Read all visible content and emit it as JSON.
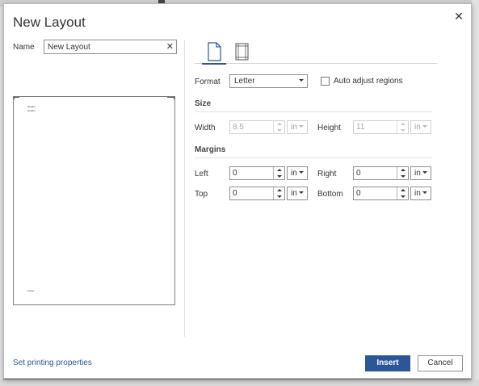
{
  "dialog": {
    "title": "New Layout",
    "close_icon": "close-icon"
  },
  "name": {
    "label": "Name",
    "value": "New Layout",
    "clear_icon": "clear-icon"
  },
  "preview": {
    "header_lines": [
      "Header",
      "Header"
    ],
    "footer_line": "Footer"
  },
  "tabs": [
    {
      "name": "page-setup",
      "icon": "page-icon",
      "selected": true
    },
    {
      "name": "margins",
      "icon": "margins-icon",
      "selected": false
    }
  ],
  "format": {
    "label": "Format",
    "value": "Letter",
    "auto_adjust_label": "Auto adjust regions",
    "auto_adjust_checked": false
  },
  "size": {
    "section_label": "Size",
    "width_label": "Width",
    "width_value": "8.5",
    "width_unit": "in",
    "height_label": "Height",
    "height_value": "11",
    "height_unit": "in"
  },
  "margins": {
    "section_label": "Margins",
    "left_label": "Left",
    "left_value": "0",
    "left_unit": "in",
    "right_label": "Right",
    "right_value": "0",
    "right_unit": "in",
    "top_label": "Top",
    "top_value": "0",
    "top_unit": "in",
    "bottom_label": "Bottom",
    "bottom_value": "0",
    "bottom_unit": "in"
  },
  "footer": {
    "link_label": "Set printing properties",
    "insert_label": "Insert",
    "cancel_label": "Cancel"
  },
  "colors": {
    "accent": "#2b579a"
  }
}
